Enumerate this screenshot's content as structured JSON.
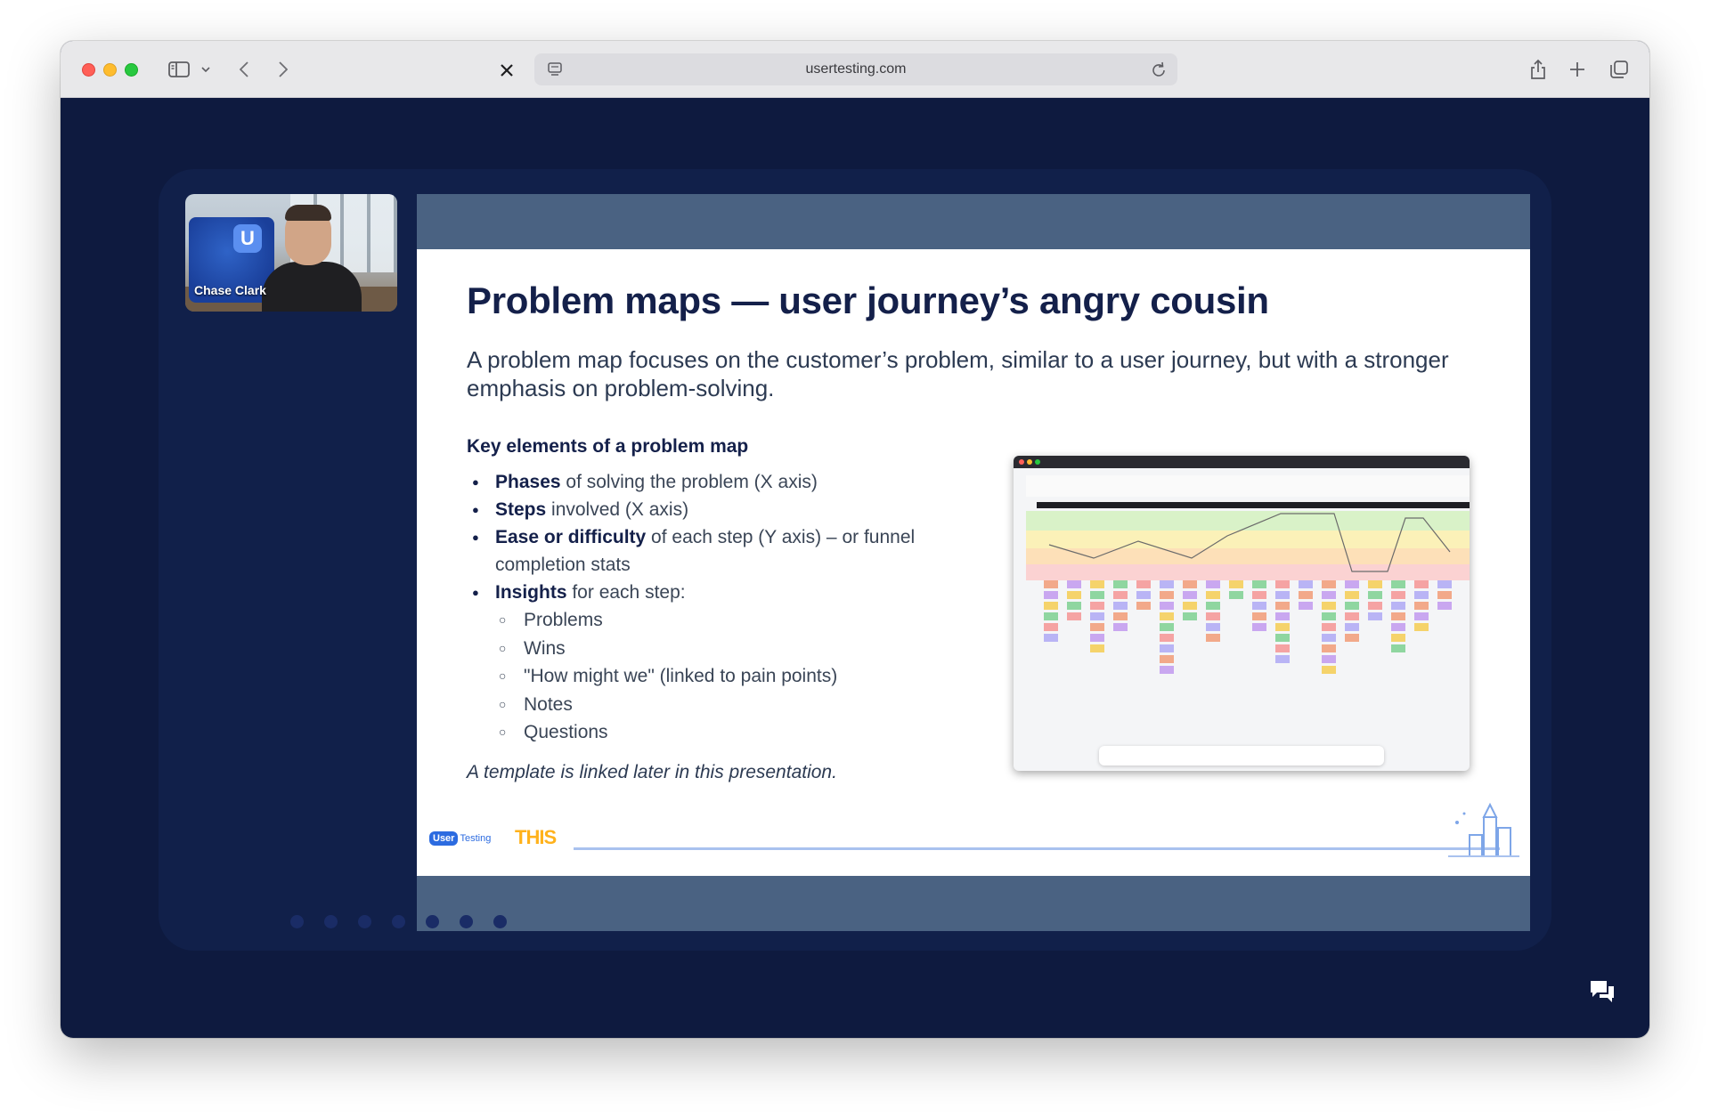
{
  "browser": {
    "url": "usertesting.com",
    "tab_close_symbol": "✕"
  },
  "speaker": {
    "name": "Chase Clark",
    "badge_letter": "U"
  },
  "slide": {
    "title": "Problem maps — user journey’s angry cousin",
    "subtitle": "A problem map focuses on the customer’s problem, similar to a user journey, but with a stronger emphasis on problem-solving.",
    "key_heading": "Key elements of a problem map",
    "bullets": [
      {
        "bold": "Phases",
        "rest": " of solving the problem (X axis)"
      },
      {
        "bold": "Steps",
        "rest": " involved (X axis)"
      },
      {
        "bold": "Ease or difficulty",
        "rest": " of each step (Y axis) – or funnel completion stats"
      },
      {
        "bold": "Insights",
        "rest": " for each step:"
      }
    ],
    "insights": [
      "Problems",
      "Wins",
      "\"How might we\" (linked to pain points)",
      "Notes",
      "Questions"
    ],
    "note": "A template is linked later in this presentation.",
    "logos": {
      "usertesting_pill": "User",
      "usertesting_text": "Testing",
      "this_logo": "THIS"
    }
  },
  "colors": {
    "background": "#0e1a3f",
    "stage": "#11204a",
    "slide_band": "#4a6282",
    "title": "#14204a"
  },
  "icons": [
    "sidebar-icon",
    "chevron-down-icon",
    "back-icon",
    "forward-icon",
    "close-icon",
    "site-settings-icon",
    "reload-icon",
    "share-icon",
    "new-tab-icon",
    "tab-overview-icon",
    "chat-icon"
  ]
}
